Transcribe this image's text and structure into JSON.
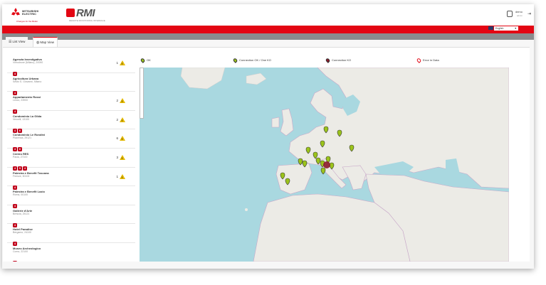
{
  "header": {
    "brand_logo_text": "MITSUBISHI ELECTRIC",
    "brand_slogan": "Changes for the Better",
    "app_logo_text": "RMI",
    "app_logo_sub": "REMOTE MONITORING INTERFACE",
    "user_name": "demo",
    "user_sub": "admin"
  },
  "toolbar": {
    "language": "English"
  },
  "tabs": [
    {
      "label": "List View",
      "icon": "list-icon"
    },
    {
      "label": "Map View",
      "icon": "globe-icon"
    }
  ],
  "sites": [
    {
      "name": "Agenzia Investigativa",
      "loc": "Vimodrone (Milano), 20090",
      "badges": [
        "4"
      ],
      "alarms": "1"
    },
    {
      "name": "Agricoltura Urbana",
      "loc": "Sesto S. Giovanni, Milano",
      "badges": [
        "4"
      ],
      "alarms": ""
    },
    {
      "name": "Appartamento Rossi",
      "loc": "Lecco, 23900",
      "badges": [
        "4"
      ],
      "alarms": "2"
    },
    {
      "name": "Condominio La Gilda",
      "loc": "Vercelli, 13100",
      "badges": [
        "4",
        "6"
      ],
      "alarms": "2"
    },
    {
      "name": "Condominio Le Rondini",
      "loc": "Piacenza, 29121",
      "badges": [
        "4",
        "6"
      ],
      "alarms": "6"
    },
    {
      "name": "Centro RES",
      "loc": "Pavia, 27100",
      "badges": [
        "4",
        "5",
        "4"
      ],
      "alarms": "3"
    },
    {
      "name": "Palestra e Benefit Toscana",
      "loc": "Firenze, 50100",
      "badges": [
        "4"
      ],
      "alarms": "1"
    },
    {
      "name": "Palestra e Benefit Lazio",
      "loc": "Roma, 00100",
      "badges": [
        "4"
      ],
      "alarms": ""
    },
    {
      "name": "Gallerie d'Arte",
      "loc": "Brescia, 25121",
      "badges": [
        "4"
      ],
      "alarms": ""
    },
    {
      "name": "Hotel Paradise",
      "loc": "Bergamo, 24100",
      "badges": [
        "4"
      ],
      "alarms": ""
    },
    {
      "name": "Museo Archeologico",
      "loc": "Como, 22100",
      "badges": [
        "4"
      ],
      "alarms": ""
    }
  ],
  "legend": [
    {
      "label": "OK",
      "color": "#9bc31c"
    },
    {
      "label": "Connection OK / One KO",
      "color": "#9bc31c"
    },
    {
      "label": "Connection KO",
      "color": "#8b1b2a"
    },
    {
      "label": "Error in Data",
      "color": "#e30613"
    }
  ],
  "colors": {
    "accent": "#e30613",
    "sea": "#a9d8e0",
    "land": "#ecebe6",
    "border": "#c8a8c8"
  }
}
